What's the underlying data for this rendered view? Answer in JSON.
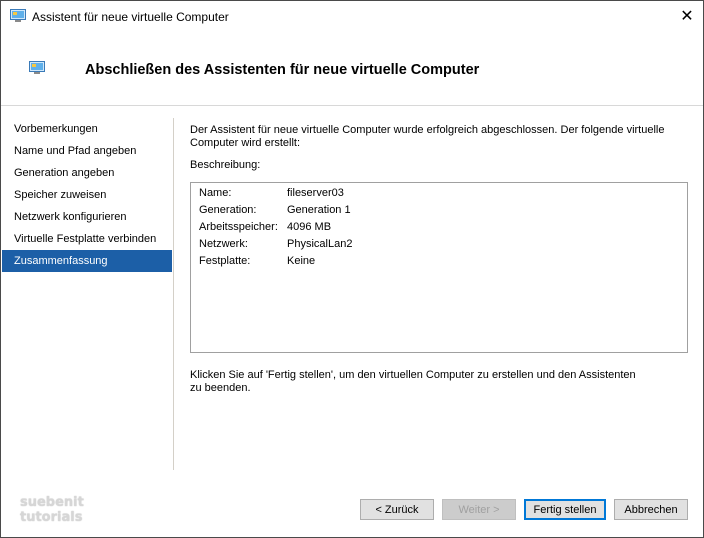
{
  "window": {
    "title": "Assistent für neue virtuelle Computer",
    "close_glyph": "✕",
    "icon": "virtual-machine-icon"
  },
  "header": {
    "title": "Abschließen des Assistenten für neue virtuelle Computer",
    "icon": "virtual-machine-icon"
  },
  "nav": {
    "items": [
      {
        "label": "Vorbemerkungen",
        "active": false
      },
      {
        "label": "Name und Pfad angeben",
        "active": false
      },
      {
        "label": "Generation angeben",
        "active": false
      },
      {
        "label": "Speicher zuweisen",
        "active": false
      },
      {
        "label": "Netzwerk konfigurieren",
        "active": false
      },
      {
        "label": "Virtuelle Festplatte verbinden",
        "active": false
      },
      {
        "label": "Zusammenfassung",
        "active": true
      }
    ]
  },
  "content": {
    "intro": "Der Assistent für neue virtuelle Computer wurde erfolgreich abgeschlossen. Der folgende virtuelle Computer wird erstellt:",
    "description_label": "Beschreibung:",
    "summary": [
      {
        "key": "Name:",
        "value": "fileserver03"
      },
      {
        "key": "Generation:",
        "value": "Generation 1"
      },
      {
        "key": "Arbeitsspeicher:",
        "value": "4096 MB"
      },
      {
        "key": "Netzwerk:",
        "value": "PhysicalLan2"
      },
      {
        "key": "Festplatte:",
        "value": "Keine"
      }
    ],
    "outro": "Klicken Sie auf 'Fertig stellen', um den virtuellen Computer zu erstellen und den Assistenten zu beenden."
  },
  "buttons": {
    "back": "< Zurück",
    "next": "Weiter >",
    "finish": "Fertig stellen",
    "cancel": "Abbrechen"
  },
  "watermark": {
    "line1": "suebenit",
    "line2": "tutorials"
  },
  "colors": {
    "nav_active_bg": "#1c5fa7",
    "default_button_border": "#0078d7"
  }
}
